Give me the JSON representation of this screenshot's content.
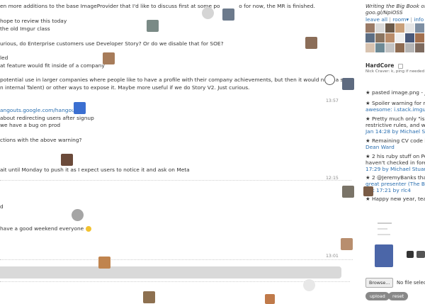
{
  "chat": {
    "messages": [
      "en more additions to the base ImageProvider that I'd like to discuss first at some po",
      "o for now, the MR is finished.",
      "hope to review this today",
      "the old Imgur class",
      "urious, do Enterprise customers use Developer Story? Or do we disable that for SOE?",
      "led",
      "at feature would fit inside of a company",
      "potential use in larger companies where people like to have a profile with their company achievements, but then it would need a search",
      "n internal Talent) or other ways to expose it. Maybe more useful if we do Story V2. Just curious.",
      "angouts.google.com/hangouts",
      "about redirecting users after signup",
      "we have a bug on prod",
      "ctions with the above warning?",
      "ait until Monday to push it as I expect users to notice it and ask on Meta",
      "d",
      "have a good weekend everyone"
    ],
    "timestamps": [
      "13:57",
      "12:15",
      "13:01"
    ]
  },
  "sidebar": {
    "description_line1": "Writing the Big Book of D",
    "description_line2": "goo.gl/NpiOSS",
    "leave_all": "leave all",
    "room_menu": "room▾",
    "info": "info",
    "room_name": "HardCore",
    "room_icon": "lock",
    "room_sub": "Nick Craver: k, ping if needed",
    "starred": [
      "★ pasted image.png - Jan",
      "★ Spoiler warning for next",
      "awesome: i.stack.imgur.co",
      "★ Pretty much only \"is mi",
      "restrictive rules, and we m",
      "Jan 14:28 by Michael Stu",
      "★ Remaining CV code is",
      "Dean Ward",
      "★ 2 his ruby stuff on Peep",
      "haven't checked in forever",
      "17:29 by Michael Stuart",
      "★ 2 @JeremyBanks thanks",
      "great presenter (The Birth",
      "t at 17:21 by rlc4",
      "★ Happy new year, team"
    ],
    "browse_label": "Browse...",
    "no_file": "No file selec",
    "upload_label": "upload",
    "reset_label": "reset"
  },
  "colors": {
    "link": "#2a6fb0",
    "bar": "#d9d9d9",
    "button": "#888888"
  }
}
